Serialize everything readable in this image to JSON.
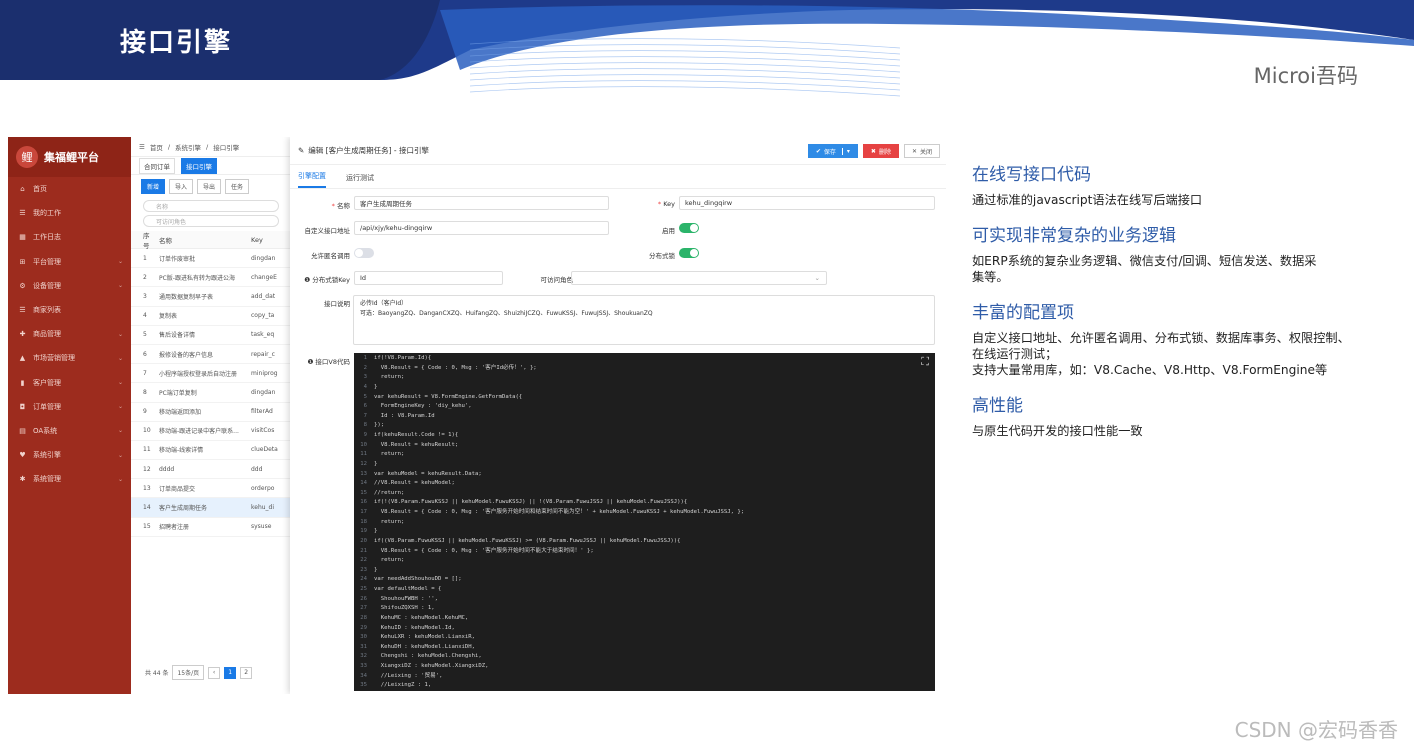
{
  "slide": {
    "title": "接口引擎",
    "brand": "Microi吾码",
    "watermark": "CSDN @宏码香香"
  },
  "sidebar": {
    "logo": "集福鲤平台",
    "items": [
      {
        "icon": "home-icon",
        "glyph": "⌂",
        "label": "首页",
        "arrow": false
      },
      {
        "icon": "list-icon",
        "glyph": "☰",
        "label": "我的工作",
        "arrow": false
      },
      {
        "icon": "calendar-icon",
        "glyph": "▦",
        "label": "工作日志",
        "arrow": false
      },
      {
        "icon": "platform-icon",
        "glyph": "⊞",
        "label": "平台管理",
        "arrow": true
      },
      {
        "icon": "device-icon",
        "glyph": "⚙",
        "label": "设备管理",
        "arrow": true
      },
      {
        "icon": "list-icon",
        "glyph": "☰",
        "label": "商家列表",
        "arrow": false
      },
      {
        "icon": "cart-icon",
        "glyph": "✚",
        "label": "商品管理",
        "arrow": true
      },
      {
        "icon": "market-icon",
        "glyph": "▲",
        "label": "市场营销管理",
        "arrow": true
      },
      {
        "icon": "customer-icon",
        "glyph": "▮",
        "label": "客户管理",
        "arrow": true
      },
      {
        "icon": "order-icon",
        "glyph": "◘",
        "label": "订单管理",
        "arrow": true
      },
      {
        "icon": "oa-icon",
        "glyph": "▤",
        "label": "OA系统",
        "arrow": true
      },
      {
        "icon": "engine-icon",
        "glyph": "♥",
        "label": "系统引擎",
        "arrow": true
      },
      {
        "icon": "gear-icon",
        "glyph": "✱",
        "label": "系统管理",
        "arrow": true
      }
    ]
  },
  "list": {
    "breadcrumb": [
      "首页",
      "系统引擎",
      "接口引擎"
    ],
    "tabs": [
      "合同订单",
      "接口引擎"
    ],
    "buttons": [
      "新增",
      "导入",
      "导出",
      "任务"
    ],
    "search_placeholder": "名称",
    "search2_placeholder": "可访问角色",
    "columns": [
      "序号",
      "名称",
      "Key"
    ],
    "rows": [
      [
        "1",
        "订单作废审批",
        "dingdan"
      ],
      [
        "2",
        "PC版-跟进私有转为跟进公海",
        "changeE"
      ],
      [
        "3",
        "通用数据复制早子表",
        "add_dat"
      ],
      [
        "4",
        "复制表",
        "copy_ta"
      ],
      [
        "5",
        "售后设备详情",
        "task_eq"
      ],
      [
        "6",
        "报修设备的客户信息",
        "repair_c"
      ],
      [
        "7",
        "小程序端授权登录后自动注册",
        "miniprog"
      ],
      [
        "8",
        "PC端订单复制",
        "dingdan"
      ],
      [
        "9",
        "移动端返回添加",
        "filterAd"
      ],
      [
        "10",
        "移动端-跟进记录中客户联系...",
        "visitCos"
      ],
      [
        "11",
        "移动端-线索详情",
        "clueDeta"
      ],
      [
        "12",
        "dddd",
        "ddd"
      ],
      [
        "13",
        "订单商品提交",
        "orderpo"
      ],
      [
        "14",
        "客户生成周期任务",
        "kehu_di"
      ],
      [
        "15",
        "招聘者注册",
        "sysuse"
      ]
    ],
    "total": "共 44 条",
    "page_size": "15条/页",
    "pages": [
      "1",
      "2"
    ]
  },
  "modal": {
    "title": "编辑 [客户生成周期任务] - 接口引擎",
    "save": "保存",
    "delete": "删除",
    "close": "关闭",
    "tabs": [
      "引擎配置",
      "运行测试"
    ],
    "fields": {
      "name_label": "名称",
      "name_value": "客户生成周期任务",
      "key_label": "Key",
      "key_value": "kehu_dingqirw",
      "url_label": "自定义接口地址",
      "url_value": "/api/xjy/kehu-dingqirw",
      "enabled_label": "启用",
      "anon_label": "允许匿名调用",
      "lock_label": "分布式锁",
      "lockkey_label": "分布式锁Key",
      "lockkey_value": "Id",
      "roles_label": "可访问角色",
      "desc_label": "接口说明",
      "desc_line1": "必传Id（客户Id）",
      "desc_line2": "可选：BaoyangZQ、DanganCXZQ、HuifangZQ、ShuizhiJCZQ、FuwuKSSJ、FuwuJSSJ、ShoukuanZQ",
      "code_label": "接口V8代码"
    },
    "enabled": true,
    "anon": false,
    "lock": true,
    "code": [
      "if(!V8.Param.Id){",
      "  V8.Result = { Code : 0, Msg : '客户Id必传！', };",
      "  return;",
      "}",
      "var kehuResult = V8.FormEngine.GetFormData({",
      "  FormEngineKey : 'diy_kehu',",
      "  Id : V8.Param.Id",
      "});",
      "if(kehuResult.Code != 1){",
      "  V8.Result = kehuResult;",
      "  return;",
      "}",
      "var kehuModel = kehuResult.Data;",
      "//V8.Result = kehuModel;",
      "//return;",
      "if(!(V8.Param.FuwuKSSJ || kehuModel.FuwuKSSJ) || !(V8.Param.FuwuJSSJ || kehuModel.FuwuJSSJ)){",
      "  V8.Result = { Code : 0, Msg : '客户服务开始时间和结束时间不能为空！' + kehuModel.FuwuKSSJ + kehuModel.FuwuJSSJ, };",
      "  return;",
      "}",
      "if((V8.Param.FuwuKSSJ || kehuModel.FuwuKSSJ) >= (V8.Param.FuwuJSSJ || kehuModel.FuwuJSSJ)){",
      "  V8.Result = { Code : 0, Msg : '客户服务开始时间不能大于结束时间！' };",
      "  return;",
      "}",
      "var needAddShouhouDD = [];",
      "var defaultModel = {",
      "  ShouhouFWBH : '',",
      "  ShifouZQXSH : 1,",
      "  KehuMC : kehuModel.KehuMC,",
      "  KehuID : kehuModel.Id,",
      "  KehuLXR : kehuModel.LianxiR,",
      "  KehuDH : kehuModel.LianxiDH,",
      "  Chengshi : kehuModel.Chengshi,",
      "  XiangxiDZ : kehuModel.XiangxiDZ,",
      "  //Leixing : '贸易',",
      "  //LeixingZ : 1,"
    ]
  },
  "features": [
    {
      "title": "在线写接口代码",
      "body": "通过标准的javascript语法在线写后端接口"
    },
    {
      "title": "可实现非常复杂的业务逻辑",
      "body": "如ERP系统的复杂业务逻辑、微信支付/回调、短信发送、数据采\n集等。"
    },
    {
      "title": "丰富的配置项",
      "body": "自定义接口地址、允许匿名调用、分布式锁、数据库事务、权限控制、\n在线运行测试；\n支持大量常用库，如：V8.Cache、V8.Http、V8.FormEngine等"
    },
    {
      "title": "高性能",
      "body": "与原生代码开发的接口性能一致"
    }
  ]
}
